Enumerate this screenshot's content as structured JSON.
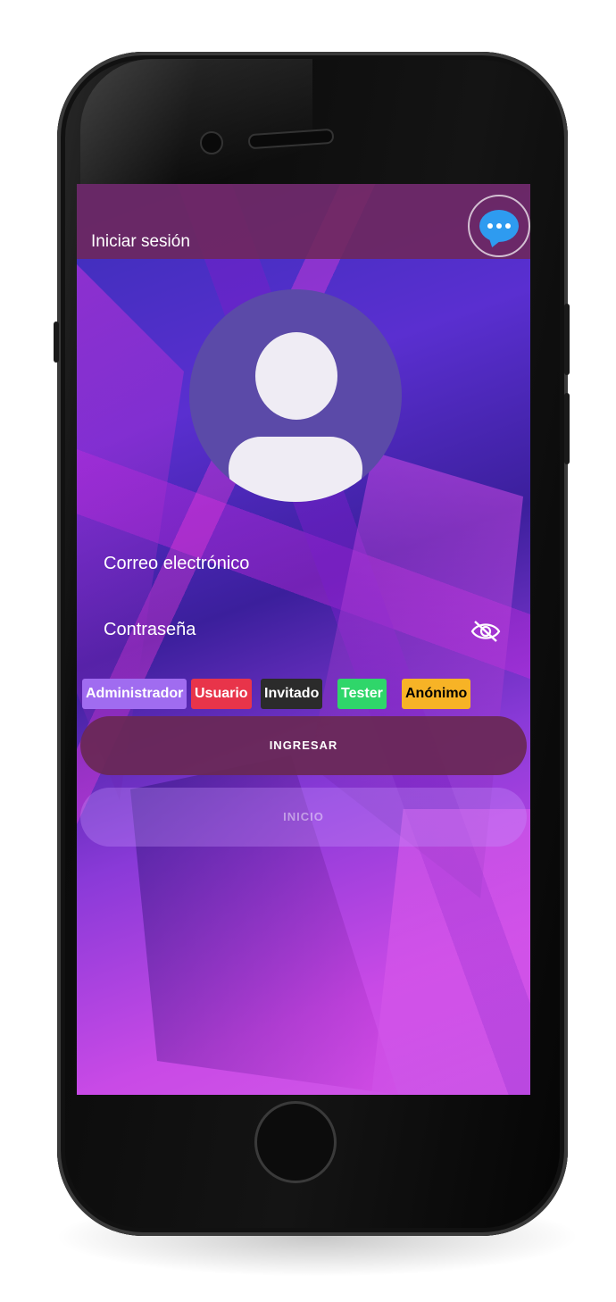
{
  "appbar": {
    "title": "Iniciar sesión",
    "chat_icon": "chat-bubble-icon"
  },
  "avatar_icon": "account-circle-icon",
  "fields": {
    "email_label": "Correo electrónico",
    "password_label": "Contraseña",
    "visibility_icon": "eye-off-icon"
  },
  "roles": [
    {
      "label": "Administrador",
      "bg": "#a06cf0",
      "fg": "#ffffff"
    },
    {
      "label": "Usuario",
      "bg": "#e8344a",
      "fg": "#ffffff"
    },
    {
      "label": "Invitado",
      "bg": "#2b2b2b",
      "fg": "#ffffff"
    },
    {
      "label": "Tester",
      "bg": "#2fd66a",
      "fg": "#ffffff"
    },
    {
      "label": "Anónimo",
      "bg": "#f7b326",
      "fg": "#000000"
    }
  ],
  "buttons": {
    "login": "INGRESAR",
    "home": "INICIO"
  },
  "colors": {
    "appbar": "#6e285a",
    "avatar": "#5b4aa8",
    "chat": "#2e9bf0"
  }
}
